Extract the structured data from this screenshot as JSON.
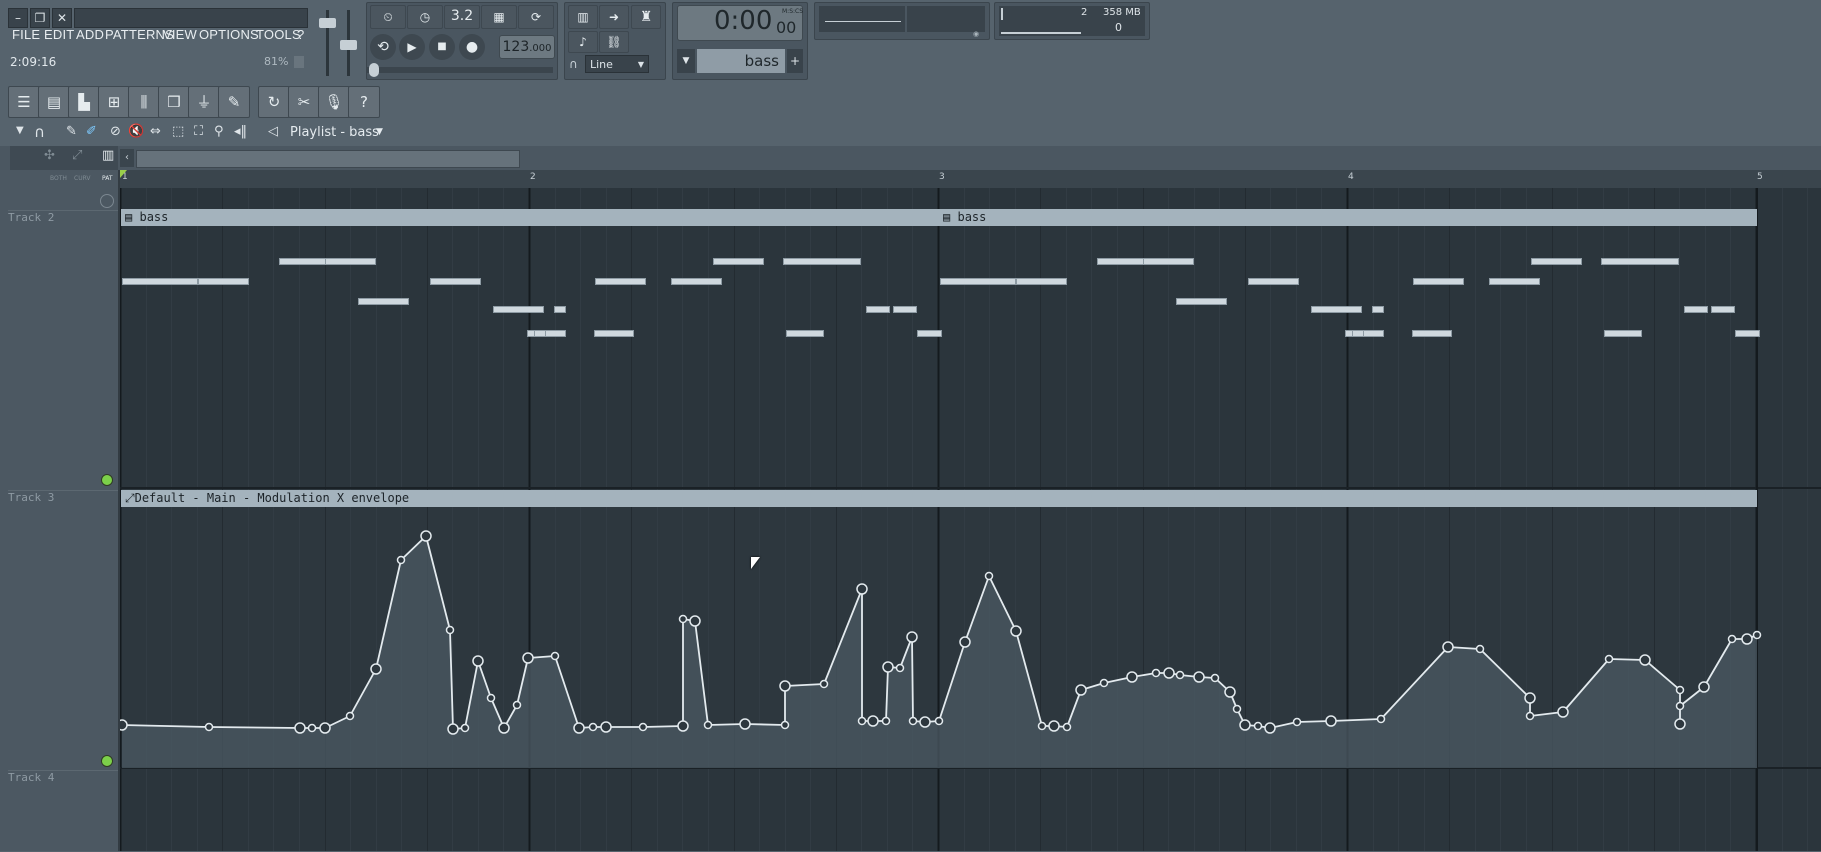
{
  "menu": [
    "FILE",
    "EDIT",
    "ADD",
    "PATTERNS",
    "VIEW",
    "OPTIONS",
    "TOOLS",
    "?"
  ],
  "status": {
    "time": "2:09:16",
    "cpu": "81%"
  },
  "transport": {
    "tempo": "123",
    "tempo_decimal": ".000",
    "time_main": "0:00",
    "time_sub": "00",
    "time_mode": "M:S:CS",
    "pattern_step": "3.2"
  },
  "snap": {
    "value": "Line"
  },
  "pattern": {
    "name": "bass"
  },
  "monitor": {
    "voices": "2",
    "ram": "358 MB",
    "zero": "0"
  },
  "playlist": {
    "title": "Playlist - bass",
    "mode_labels": [
      "BOTH",
      "CURV",
      "PAT"
    ],
    "bars": [
      "1",
      "2",
      "3",
      "4",
      "5"
    ],
    "tracks": [
      "Track 2",
      "Track 3",
      "Track 4"
    ],
    "clip_pattern_name": "bass",
    "clip_automation_name": "Default - Main - Modulation X envelope"
  },
  "colors": {
    "background": "#56636d",
    "grid": "#2a333a",
    "clip_header": "#a4b3bd",
    "notes": "#cfd8de",
    "envelope": "#e3eaee"
  },
  "icons": [
    "minimize-icon",
    "restore-icon",
    "close-icon",
    "loop-icon",
    "play-icon",
    "stop-icon",
    "record-icon",
    "piano-icon",
    "arrow-right-icon",
    "link-icon",
    "metronome-icon",
    "channel-rack-icon",
    "mixer-icon",
    "plugin-icon",
    "help-icon",
    "magnet-icon",
    "pencil-icon",
    "brush-icon",
    "delete-icon",
    "mute-icon",
    "slice-icon",
    "select-icon",
    "zoom-icon",
    "speaker-icon"
  ]
}
